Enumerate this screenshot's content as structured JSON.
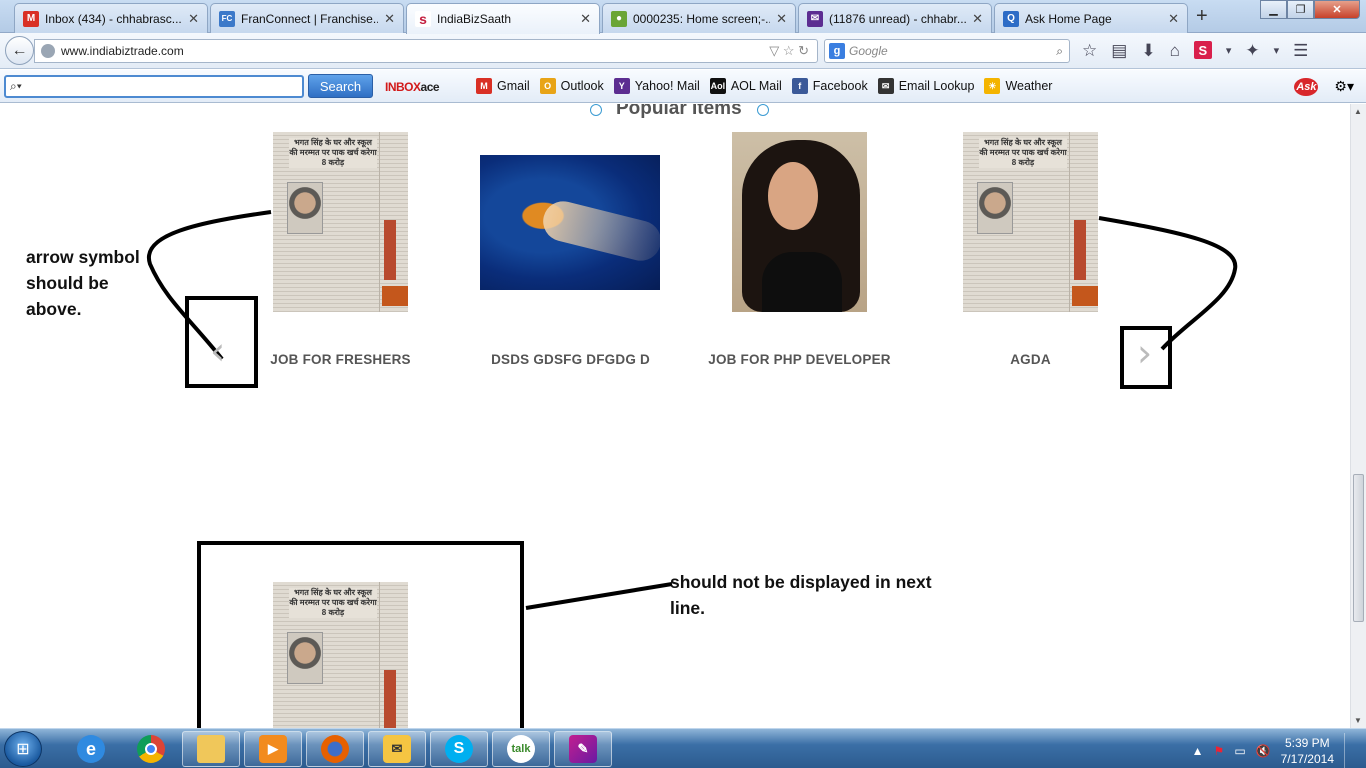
{
  "browser": {
    "tabs": [
      {
        "label": "Inbox (434) - chhabrasc...",
        "icon": "gmail-icon",
        "color": "#d93025",
        "glyph": "M"
      },
      {
        "label": "FranConnect | Franchise...",
        "icon": "franconnect-icon",
        "color": "#3c79c9",
        "glyph": "FC"
      },
      {
        "label": "IndiaBizSaath",
        "icon": "indiabizsaath-icon",
        "color": "#c41f3f",
        "glyph": "s"
      },
      {
        "label": "0000235: Home screen;-...",
        "icon": "mantis-icon",
        "color": "#6aa536",
        "glyph": "●"
      },
      {
        "label": "(11876 unread) - chhabr...",
        "icon": "yahoo-mail-icon",
        "color": "#5c2d91",
        "glyph": "✉"
      },
      {
        "label": "Ask Home Page",
        "icon": "ask-search-icon",
        "color": "#2d6cc6",
        "glyph": "Q"
      }
    ],
    "url": "www.indiabiztrade.com",
    "search_placeholder": "Google"
  },
  "asktoolbar": {
    "search_button": "Search",
    "inboxace": "INBOX",
    "inboxace_suffix": "ace",
    "items": [
      {
        "label": "Gmail",
        "color": "#d93025",
        "glyph": "M"
      },
      {
        "label": "Outlook",
        "color": "#e8a417",
        "glyph": "O"
      },
      {
        "label": "Yahoo! Mail",
        "color": "#5c2d91",
        "glyph": "Y"
      },
      {
        "label": "AOL Mail",
        "color": "#111111",
        "glyph": "Aol"
      },
      {
        "label": "Facebook",
        "color": "#3b5998",
        "glyph": "f"
      },
      {
        "label": "Email Lookup",
        "color": "#333333",
        "glyph": "✉"
      },
      {
        "label": "Weather",
        "color": "#f4b400",
        "glyph": "☀"
      }
    ],
    "ask_logo": "Ask"
  },
  "page": {
    "section_title": "Popular Items",
    "items": [
      {
        "label": "JOB FOR FRESHERS",
        "image": "newspaper"
      },
      {
        "label": "DSDS GDSFG DFGDG D",
        "image": "jellyfish"
      },
      {
        "label": "JOB FOR PHP DEVELOPER",
        "image": "portrait"
      },
      {
        "label": "AGDA",
        "image": "newspaper"
      }
    ],
    "newspaper_headline": "भगत सिंह के घर और स्कूल की मरम्मत पर पाक खर्च करेगा 8 करोड़",
    "prev_arrow": "‹",
    "next_arrow": "›"
  },
  "annotations": {
    "arrow_note": "arrow symbol should be above.",
    "line_note": "should not be displayed in next line."
  },
  "taskbar": {
    "time": "5:39 PM",
    "date": "7/17/2014"
  }
}
